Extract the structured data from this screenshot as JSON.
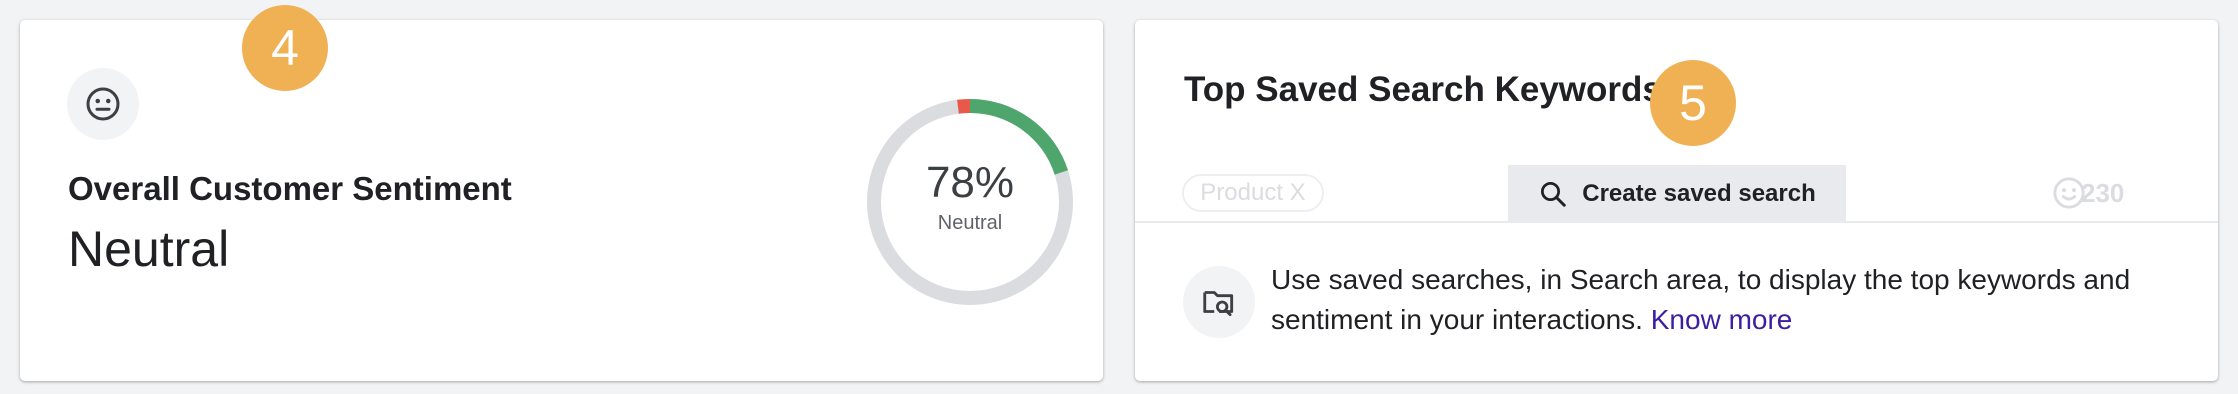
{
  "sentiment_card": {
    "icon": "neutral-face-icon",
    "step_badge": "4",
    "title": "Overall Customer Sentiment",
    "value": "Neutral",
    "donut": {
      "percent_label": "78%",
      "caption": "Neutral",
      "segments": [
        {
          "name": "neutral",
          "fraction": 0.78,
          "color": "#dadce0"
        },
        {
          "name": "positive",
          "fraction": 0.2,
          "color": "#4fa66c"
        },
        {
          "name": "negative",
          "fraction": 0.02,
          "color": "#e8594a"
        }
      ]
    }
  },
  "keywords_card": {
    "title": "Top Saved Search Keywords",
    "step_badge": "5",
    "chip_label": "Product X",
    "create_button_label": "Create saved search",
    "create_button_icon": "search-icon",
    "ghost_count": "230",
    "info_icon": "folder-search-icon",
    "info_text": "Use saved searches, in Search area, to display the top keywords and sentiment in your interactions.",
    "info_link": "Know more"
  },
  "colors": {
    "badge": "#f0b154",
    "link": "#3b1ea1",
    "positive": "#4fa66c",
    "negative": "#e8594a",
    "neutral_track": "#dadce0"
  }
}
